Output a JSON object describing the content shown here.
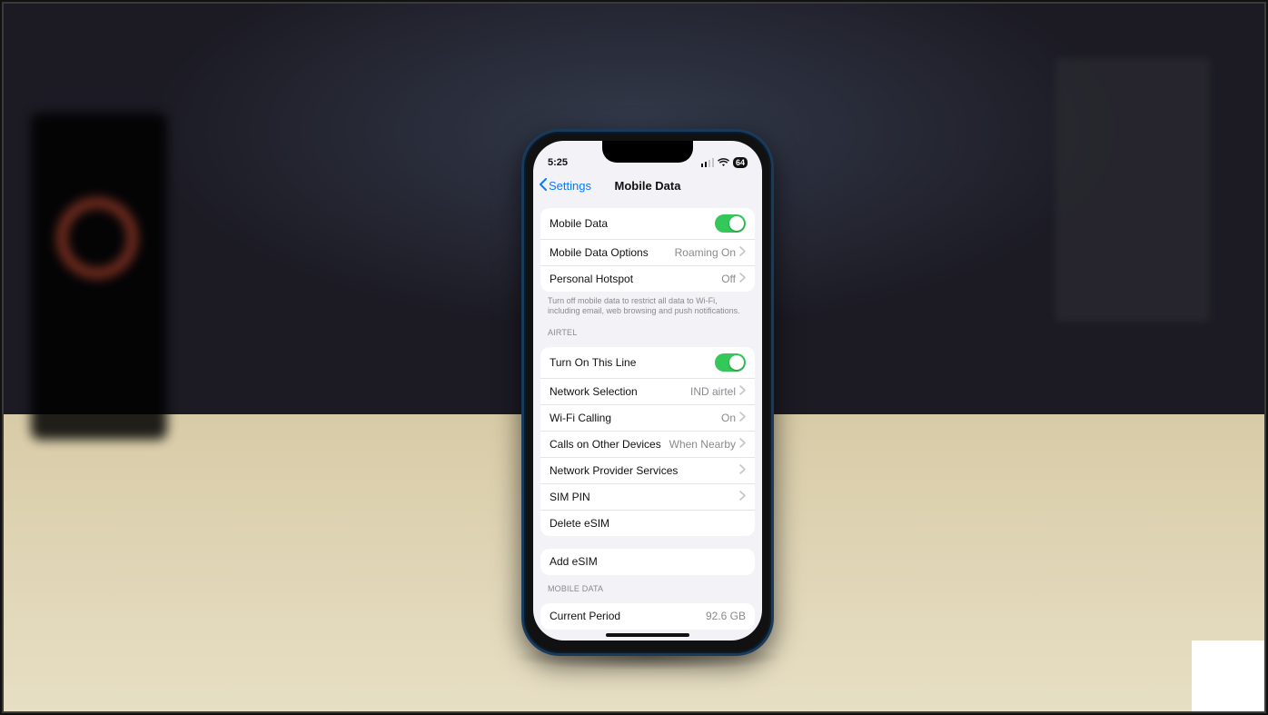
{
  "status": {
    "time": "5:25",
    "battery": "64"
  },
  "nav": {
    "back": "Settings",
    "title": "Mobile Data"
  },
  "group1": {
    "mobile_data": "Mobile Data",
    "mobile_data_options": "Mobile Data Options",
    "mobile_data_options_detail": "Roaming On",
    "personal_hotspot": "Personal Hotspot",
    "personal_hotspot_detail": "Off",
    "footer": "Turn off mobile data to restrict all data to Wi-Fi, including email, web browsing and push notifications."
  },
  "carrier_header": "AIRTEL",
  "carrier": {
    "turn_on_line": "Turn On This Line",
    "network_selection": "Network Selection",
    "network_selection_detail": "IND airtel",
    "wifi_calling": "Wi-Fi Calling",
    "wifi_calling_detail": "On",
    "calls_other": "Calls on Other Devices",
    "calls_other_detail": "When Nearby",
    "provider_services": "Network Provider Services",
    "sim_pin": "SIM PIN",
    "delete_esim": "Delete eSIM"
  },
  "add_esim": "Add eSIM",
  "usage_header": "MOBILE DATA",
  "usage": {
    "current_period": "Current Period",
    "current_period_detail": "92.6 GB"
  }
}
